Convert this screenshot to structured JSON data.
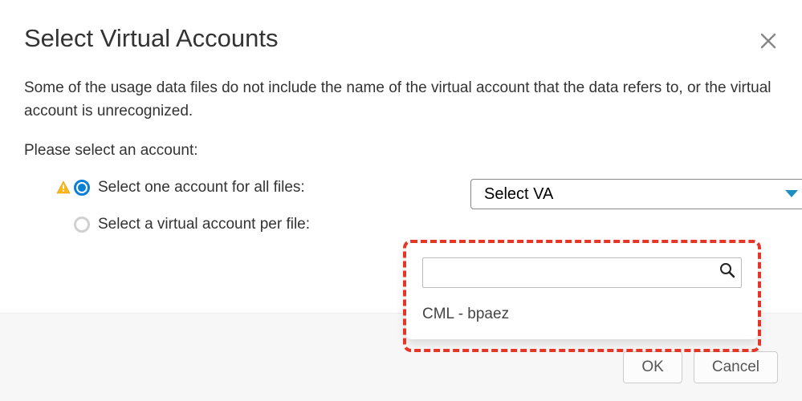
{
  "title": "Select Virtual Accounts",
  "description": "Some of the usage data files do not include the name of the virtual account that the data refers to, or the virtual account is unrecognized.",
  "prompt": "Please select an account:",
  "options": {
    "all": {
      "label": "Select one account for all files:"
    },
    "per": {
      "label": "Select a virtual account per file:"
    }
  },
  "select": {
    "placeholder": "Select VA"
  },
  "dropdown": {
    "search_value": "",
    "items": [
      "CML - bpaez"
    ]
  },
  "footer": {
    "ok": "OK",
    "cancel": "Cancel"
  }
}
